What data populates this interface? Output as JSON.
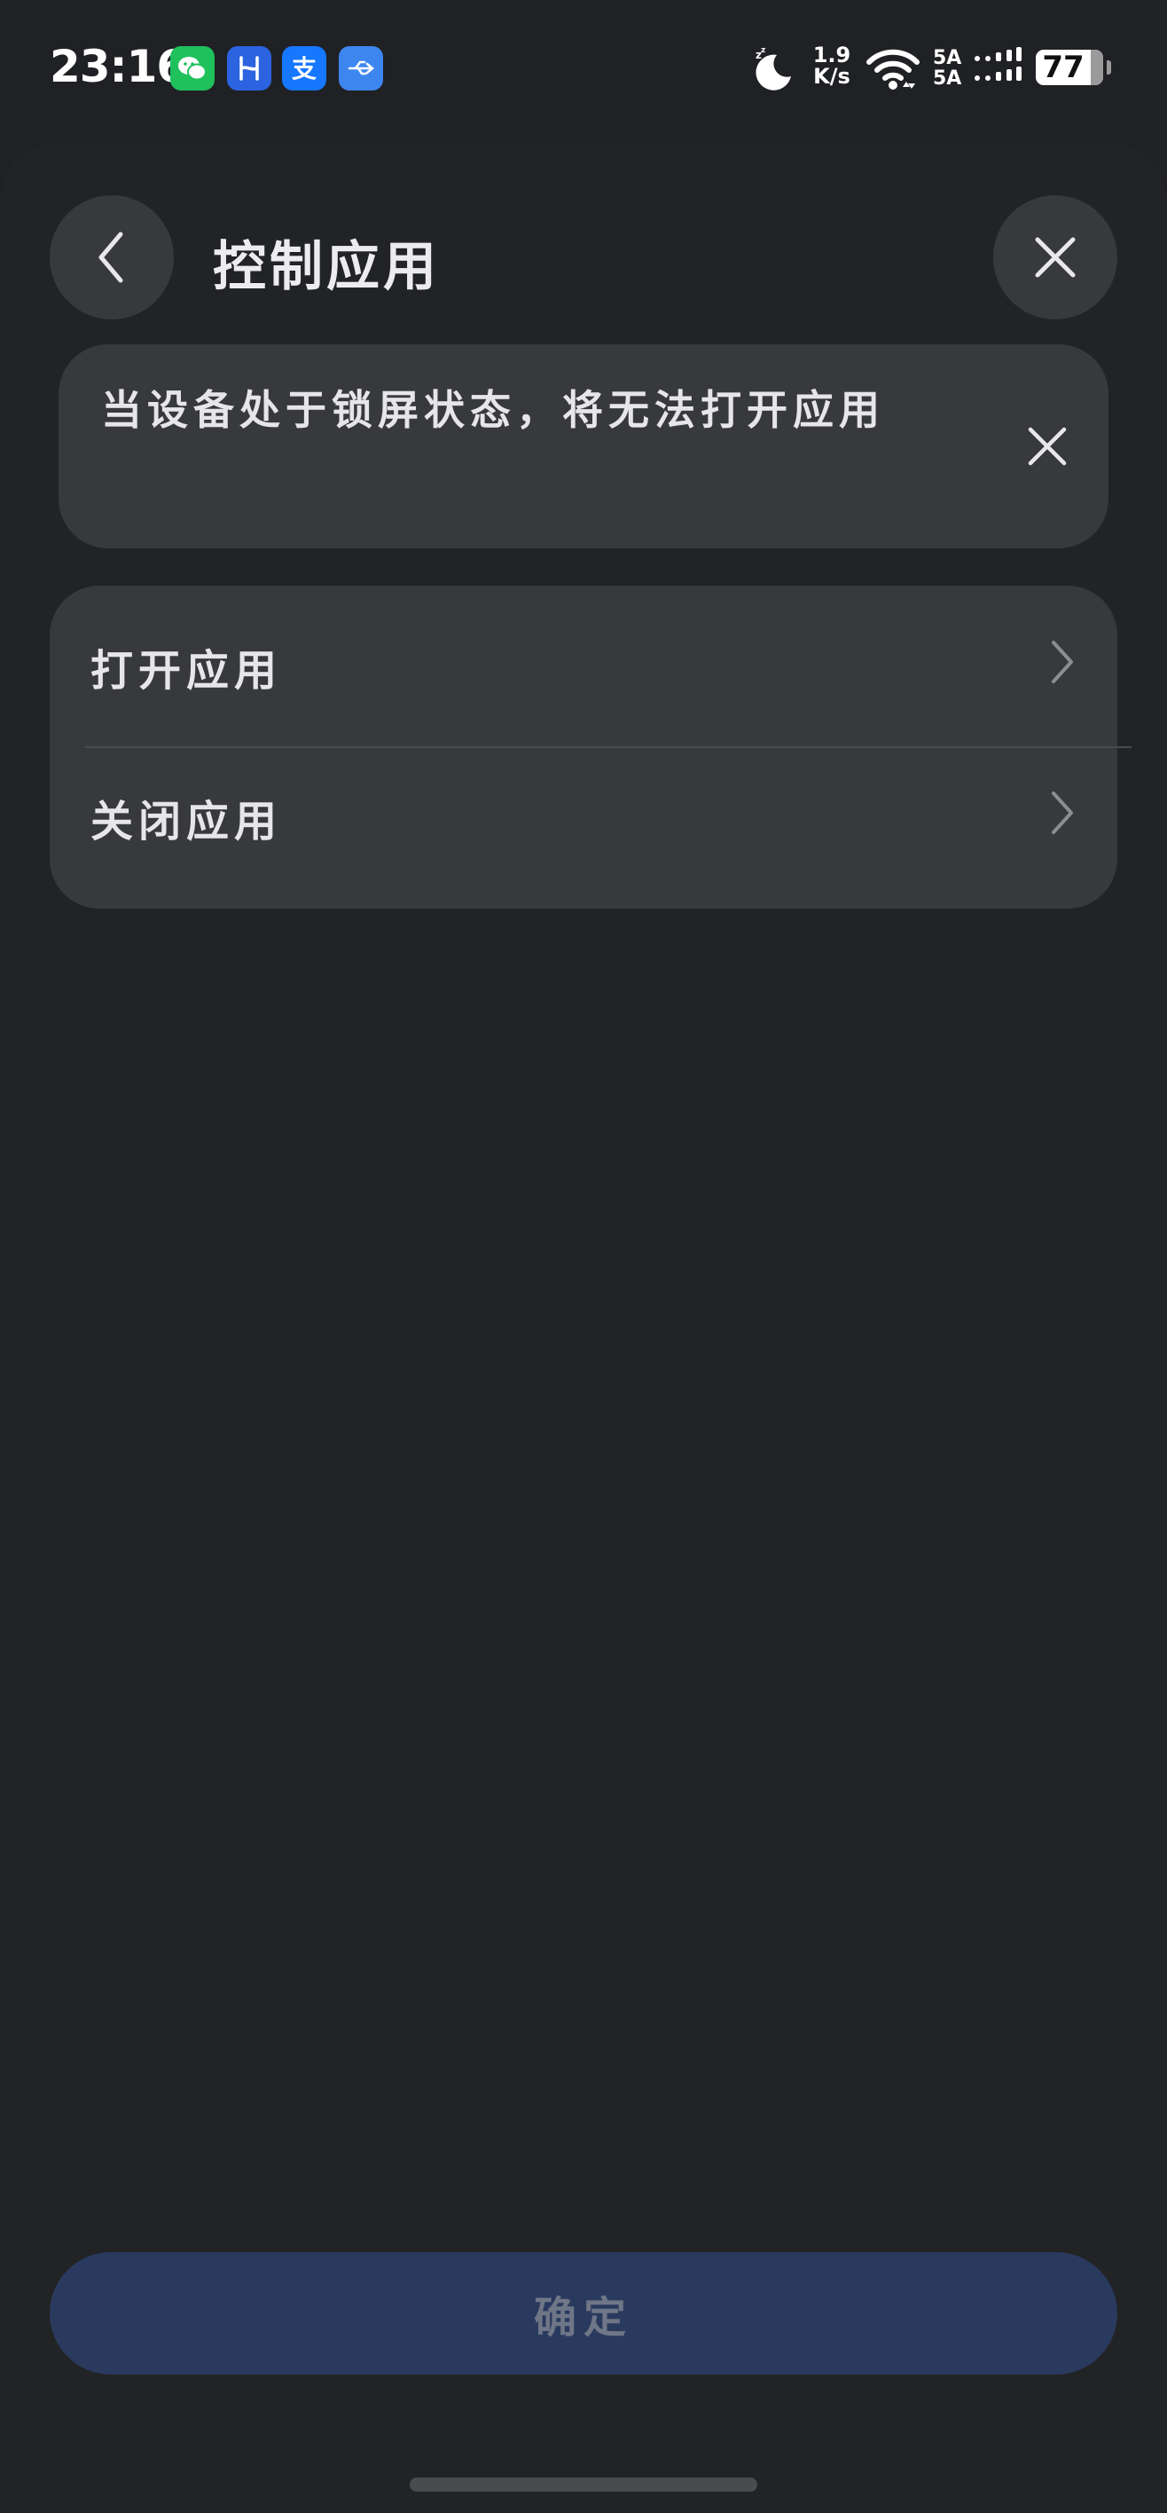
{
  "status_bar": {
    "time": "23:16",
    "apps": [
      "wechat-icon",
      "huawei-app-icon",
      "alipay-icon",
      "usb-icon"
    ],
    "net_speed_value": "1.9",
    "net_speed_unit": "K/s",
    "signal_label_1": "5A",
    "signal_label_2": "5A",
    "battery_percent": "77"
  },
  "header": {
    "title": "控制应用"
  },
  "notice": {
    "text": "当设备处于锁屏状态，将无法打开应用"
  },
  "options": [
    {
      "label": "打开应用"
    },
    {
      "label": "关闭应用"
    }
  ],
  "footer": {
    "confirm_label": "确定"
  },
  "colors": {
    "background": "#202124",
    "card": "#38393b",
    "confirm_disabled": "#2a3a5e",
    "confirm_text_disabled": "#6f7686"
  }
}
